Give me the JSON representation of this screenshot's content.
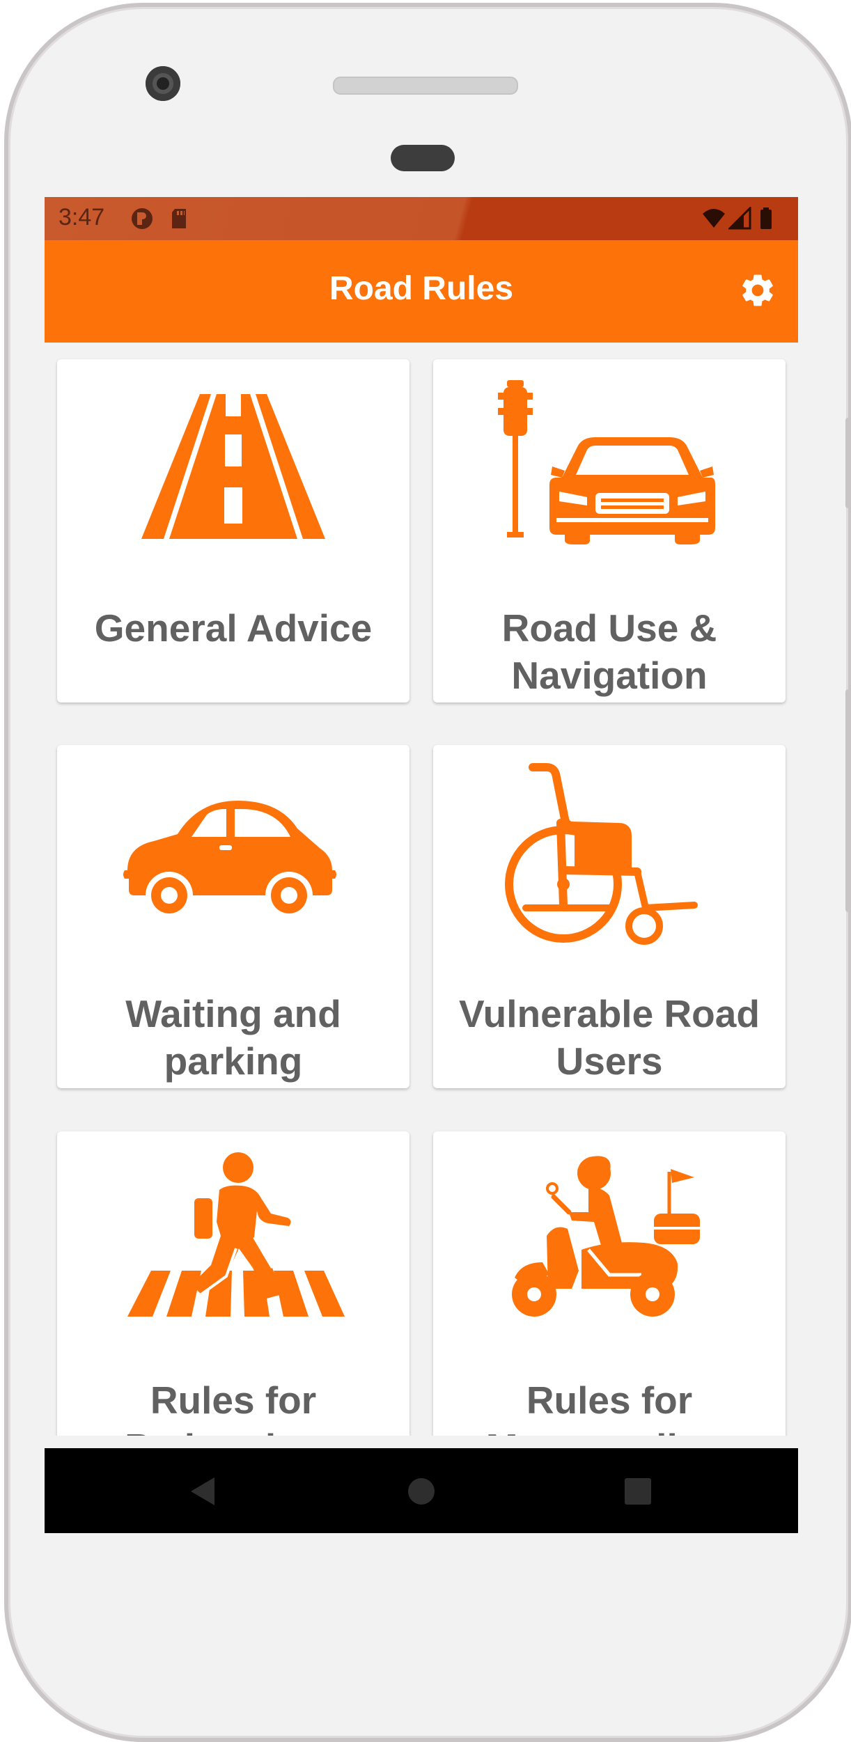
{
  "status_bar": {
    "time": "3:47",
    "icons": [
      "notification-icon",
      "sd-card-icon",
      "wifi-icon",
      "signal-icon",
      "battery-icon"
    ]
  },
  "app_bar": {
    "title": "Road Rules",
    "settings_icon": "gear-icon"
  },
  "theme": {
    "primary": "#fd7309",
    "status_bar": "#c55429",
    "card_text": "#616161",
    "background": "#f2f2f2"
  },
  "categories": [
    {
      "label": "General Advice",
      "icon": "road-icon"
    },
    {
      "label": "Road Use & Navigation",
      "icon": "traffic-light-car-icon"
    },
    {
      "label": "Waiting and parking",
      "icon": "car-icon"
    },
    {
      "label": "Vulnerable Road Users",
      "icon": "wheelchair-icon"
    },
    {
      "label": "Rules for Pedestrians",
      "icon": "pedestrian-crossing-icon"
    },
    {
      "label": "Rules for Motorcyclists",
      "icon": "scooter-icon"
    }
  ],
  "nav_bar": {
    "buttons": [
      "back-icon",
      "home-icon",
      "recents-icon"
    ]
  }
}
